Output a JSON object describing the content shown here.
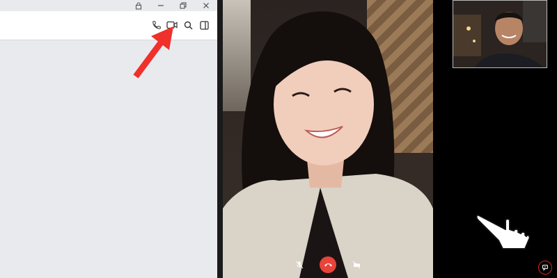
{
  "window_controls": {
    "icons": [
      "lock-icon",
      "minimize-icon",
      "restore-icon",
      "close-icon"
    ]
  },
  "chat_header": {
    "icons": [
      "phone-icon",
      "video-camera-icon",
      "search-icon",
      "side-panel-icon"
    ]
  },
  "annotations": {
    "arrow_color": "#f0302a",
    "highlight_color": "#e02020",
    "pointer": "hand-pointer-icon"
  },
  "video_call": {
    "controls": [
      "mute-microphone-icon",
      "end-call-icon",
      "video-toggle-icon"
    ],
    "end_call_color": "#e8443a",
    "chat_toggle_icon": "chat-bubble-icon"
  }
}
